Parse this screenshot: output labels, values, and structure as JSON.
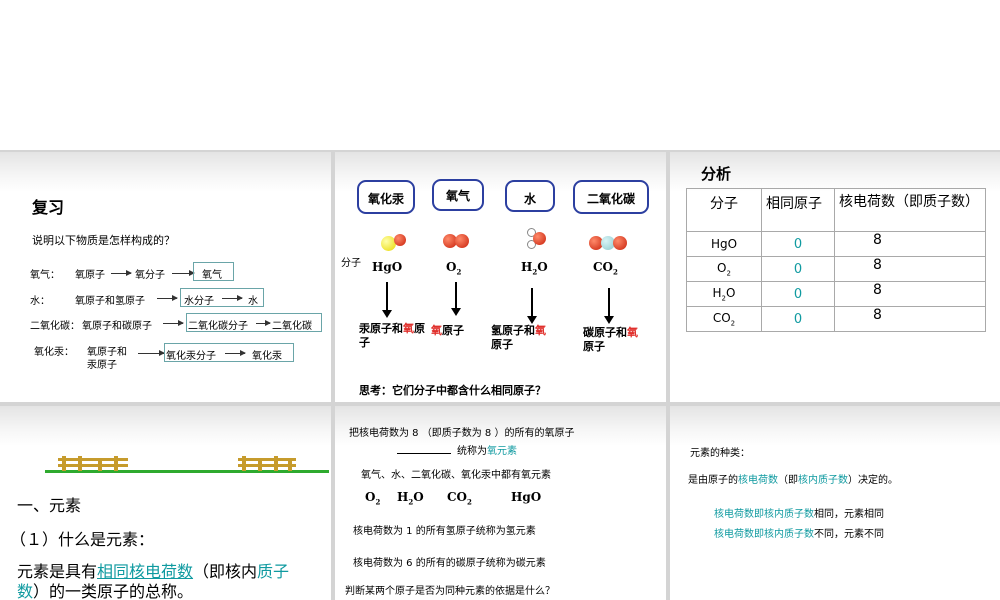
{
  "s1": {
    "title": "复习",
    "question": "说明以下物质是怎样构成的？",
    "rows": [
      {
        "label": "氧气：",
        "a": "氧原子",
        "b": "氧分子",
        "c": "氧气"
      },
      {
        "label": "水：",
        "a": "氧原子和氢原子",
        "b": "水分子",
        "c": "水"
      },
      {
        "label": "二氧化碳：",
        "a": "氧原子和碳原子",
        "b": "二氧化碳分子",
        "c": "二氧化碳"
      },
      {
        "label": "氧化汞：",
        "a1": "氧原子和",
        "a2": "汞原子",
        "b": "氧化汞分子",
        "c": "氧化汞"
      }
    ]
  },
  "s2": {
    "bubbles": [
      "氧化汞",
      "氧气",
      "水",
      "二氧化碳"
    ],
    "mol_label": "分子",
    "formulas": {
      "hgo": "HgO",
      "o": "O",
      "o_sub": "2",
      "h": "H",
      "h_sub": "2",
      "h_o": "O",
      "c": "CO",
      "c_sub": "2"
    },
    "d1a": "汞原子和",
    "d1b": "氧",
    "d1c": "原",
    "d1d": "子",
    "d2a": "氧",
    "d2b": "原子",
    "d3a": "氢原子和",
    "d3b": "氧",
    "d3c": "原子",
    "d4a": "碳原子和",
    "d4b": "氧",
    "d4c": "原子",
    "think": "思考：它们分子中都含什么相同原子？"
  },
  "s3": {
    "title": "分析",
    "headers": [
      "分子",
      "相同原子",
      "核电荷数（即质子数）"
    ],
    "rows": [
      {
        "m": "HgO",
        "atom": "0",
        "charge": "8"
      },
      {
        "m": "O",
        "sub": "2",
        "atom": "0",
        "charge": "8"
      },
      {
        "m": "H",
        "sub": "2",
        "m2": "O",
        "atom": "0",
        "charge": "8"
      },
      {
        "m": "CO",
        "sub": "2",
        "atom": "0",
        "charge": "8"
      }
    ]
  },
  "s4": {
    "h1": "一、元素",
    "h2": "（１）什么是元素：",
    "p_a": "元素是具有",
    "p_b": "相同核电荷数",
    "p_c": "（即核内",
    "p_d": "质子",
    "p_e": "数",
    "p_f": "）的一类原子的总称。"
  },
  "s5": {
    "l1": "把核电荷数为 8 （即质子数为 8 ）的所有的氧原子",
    "l2a": "统称为",
    "l2b": "氧元素",
    "l3": "氧气、水、二氧化碳、氧化汞中都有氧元素",
    "f": {
      "o": "O",
      "o_sub": "2",
      "h": "H",
      "h_sub": "2",
      "h_o": "O",
      "c": "CO",
      "c_sub": "2",
      "hgo": "HgO"
    },
    "l4": "核电荷数为 1 的所有氢原子统称为氢元素",
    "l5": "核电荷数为 6 的所有的碳原子统称为碳元素",
    "l6": "判断某两个原子是否为同种元素的依据是什么？"
  },
  "s6": {
    "title": "元素的种类：",
    "l1a": "是由原子的",
    "l1b": "核电荷数",
    "l1c": "（即",
    "l1d": "核内质子数",
    "l1e": "）决定的。",
    "l2a": "核电荷数即核内质子数",
    "l2b": "相同，元素相同",
    "l3a": "核电荷数即核内质子数",
    "l3b": "不同，元素不同"
  },
  "colors": {
    "teal": "#0f9aa0",
    "red": "#e0302c",
    "bubble_border": "#2c3fa0"
  }
}
